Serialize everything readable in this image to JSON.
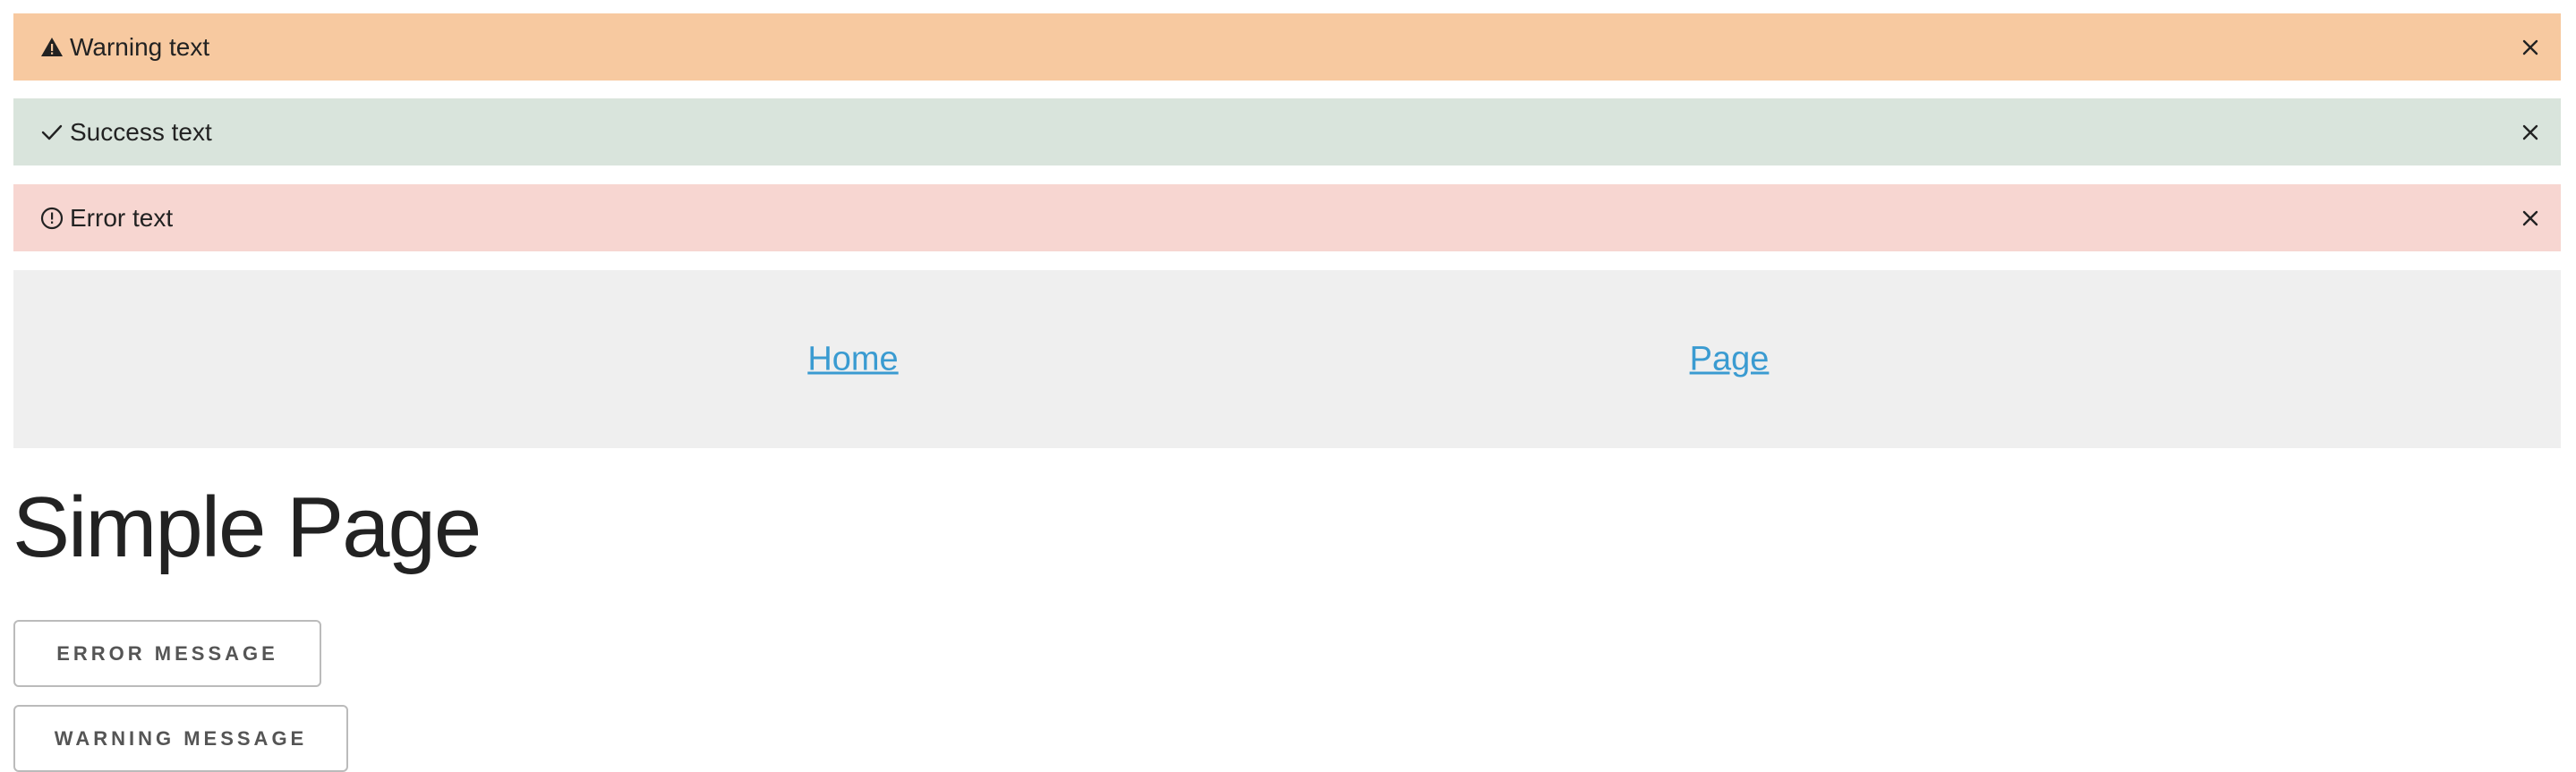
{
  "alerts": {
    "warning": {
      "text": "Warning text",
      "icon": "warning-triangle-icon",
      "color": "#f7c9a0"
    },
    "success": {
      "text": "Success text",
      "icon": "checkmark-icon",
      "color": "#d9e4dc"
    },
    "error": {
      "text": "Error text",
      "icon": "exclamation-circle-icon",
      "color": "#f7d6d1"
    }
  },
  "nav": {
    "links": [
      {
        "label": "Home"
      },
      {
        "label": "Page"
      }
    ],
    "link_color": "#3a9bd1"
  },
  "main": {
    "title": "Simple Page",
    "buttons": {
      "error_message": "ERROR MESSAGE",
      "warning_message": "WARNING MESSAGE"
    }
  }
}
